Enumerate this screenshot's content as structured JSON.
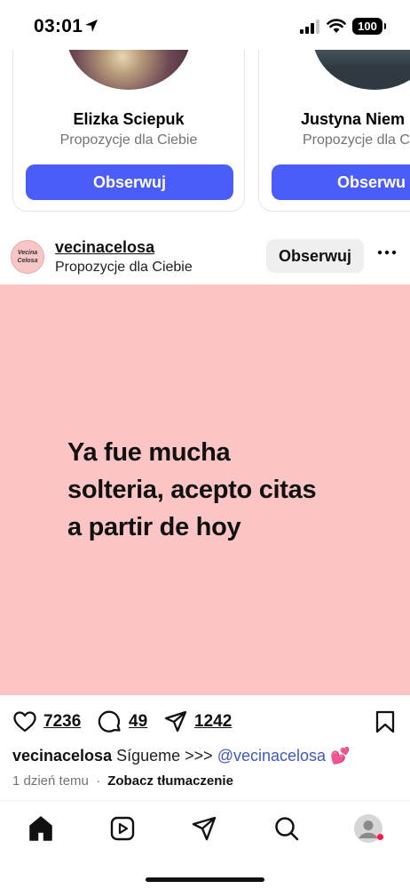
{
  "status_bar": {
    "time": "03:01",
    "battery": "100"
  },
  "suggestions": [
    {
      "name": "Elizka Sciepuk",
      "subtitle": "Propozycje dla Ciebie",
      "button": "Obserwuj"
    },
    {
      "name": "Justyna Niem",
      "subtitle": "Propozycje dla C",
      "button": "Obserwu"
    }
  ],
  "post": {
    "avatar_text_top": "Vecina",
    "avatar_text_bottom": "Celosa",
    "username": "vecinacelosa",
    "subtitle": "Propozycje dla Ciebie",
    "follow_label": "Obserwuj",
    "image_text_lines": [
      "Ya fue mucha",
      "solteria, acepto citas",
      "a partir de hoy"
    ],
    "likes": "7236",
    "comments": "49",
    "shares": "1242",
    "caption_user": "vecinacelosa",
    "caption_text": "Sígueme >>> ",
    "caption_mention": "@vecinacelosa",
    "caption_emoji": "💕",
    "time_ago": "1 dzień temu",
    "separator": "·",
    "translate_label": "Zobacz tłumaczenie",
    "background_color": "#fcc5c5"
  },
  "accent_color": "#4a5df9",
  "icons": [
    "location-arrow-icon",
    "signal-icon",
    "wifi-icon",
    "battery-icon",
    "more-icon",
    "heart-icon",
    "comment-icon",
    "share-icon",
    "bookmark-icon",
    "home-icon",
    "reels-icon",
    "direct-icon",
    "search-icon",
    "profile-icon"
  ]
}
